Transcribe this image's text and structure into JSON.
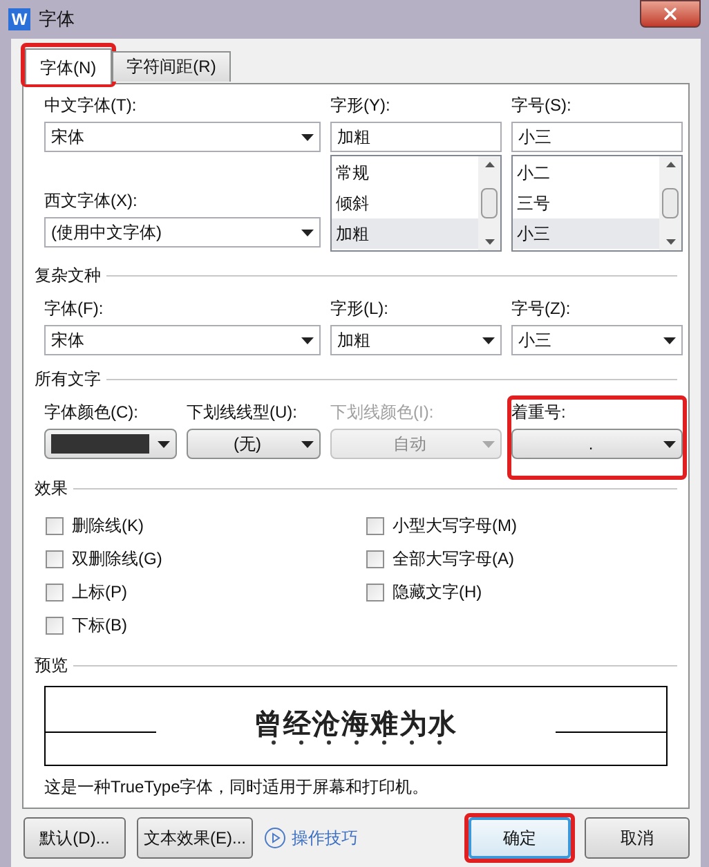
{
  "window": {
    "app_icon": "W",
    "title": "字体"
  },
  "tabs": [
    {
      "label": "字体(N)",
      "selected": true,
      "highlighted": true
    },
    {
      "label": "字符间距(R)",
      "selected": false,
      "highlighted": false
    }
  ],
  "chinese_font": {
    "label": "中文字体(T):",
    "value": "宋体"
  },
  "style": {
    "label": "字形(Y):",
    "value": "加粗",
    "options": [
      {
        "label": "常规",
        "selected": false
      },
      {
        "label": "倾斜",
        "selected": false
      },
      {
        "label": "加粗",
        "selected": true
      }
    ]
  },
  "size": {
    "label": "字号(S):",
    "value": "小三",
    "options": [
      {
        "label": "小二",
        "selected": false
      },
      {
        "label": "三号",
        "selected": false
      },
      {
        "label": "小三",
        "selected": true
      }
    ]
  },
  "western_font": {
    "label": "西文字体(X):",
    "value": "(使用中文字体)"
  },
  "complex_script": {
    "title": "复杂文种",
    "font": {
      "label": "字体(F):",
      "value": "宋体"
    },
    "style": {
      "label": "字形(L):",
      "value": "加粗"
    },
    "size": {
      "label": "字号(Z):",
      "value": "小三"
    }
  },
  "all_text": {
    "title": "所有文字",
    "font_color": {
      "label": "字体颜色(C):",
      "color": "#333333"
    },
    "underline_type": {
      "label": "下划线线型(U):",
      "value": "(无)"
    },
    "underline_color": {
      "label": "下划线颜色(I):",
      "value": "自动",
      "disabled": true
    },
    "emphasis": {
      "label": "着重号:",
      "value": ".",
      "highlighted": true
    }
  },
  "effects": {
    "title": "效果",
    "left": [
      {
        "label": "删除线(K)",
        "checked": false
      },
      {
        "label": "双删除线(G)",
        "checked": false
      },
      {
        "label": "上标(P)",
        "checked": false
      },
      {
        "label": "下标(B)",
        "checked": false
      }
    ],
    "right": [
      {
        "label": "小型大写字母(M)",
        "checked": false
      },
      {
        "label": "全部大写字母(A)",
        "checked": false
      },
      {
        "label": "隐藏文字(H)",
        "checked": false
      }
    ]
  },
  "preview": {
    "title": "预览",
    "sample": "曾经沧海难为水",
    "note": "这是一种TrueType字体，同时适用于屏幕和打印机。"
  },
  "buttons": {
    "default": "默认(D)...",
    "text_effects": "文本效果(E)...",
    "tips": "操作技巧",
    "ok": {
      "label": "确定",
      "highlighted": true
    },
    "cancel": "取消"
  }
}
